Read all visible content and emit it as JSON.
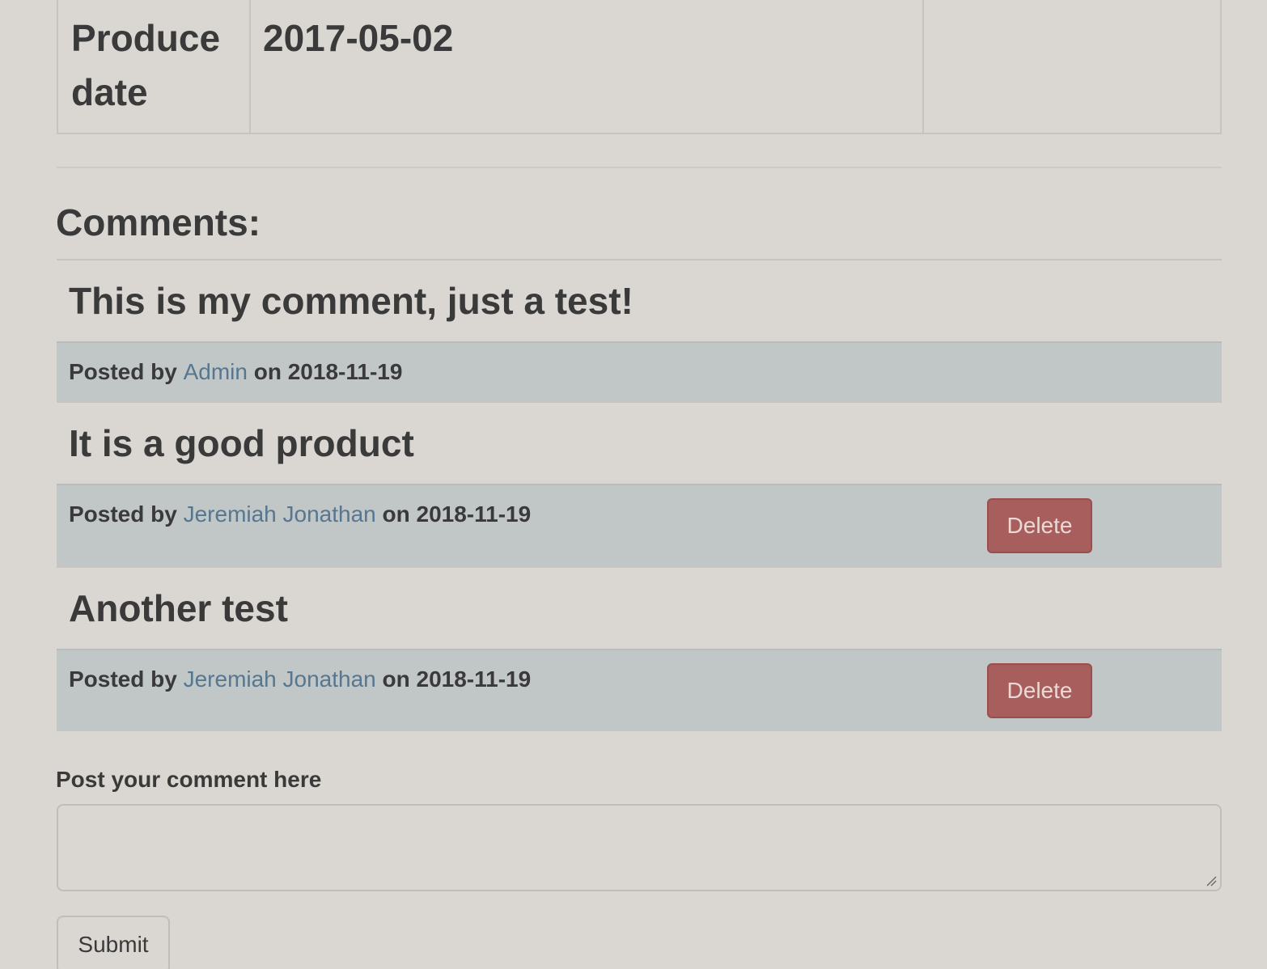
{
  "details": {
    "rows": [
      {
        "label": "Produce date",
        "value": "2017-05-02",
        "extra": ""
      }
    ]
  },
  "comments": {
    "heading": "Comments:",
    "items": [
      {
        "text": "This is my comment, just a test!",
        "posted_prefix": "Posted by ",
        "author": "Admin",
        "date_prefix": " on ",
        "date": "2018-11-19",
        "delete_label": ""
      },
      {
        "text": "It is a good product",
        "posted_prefix": "Posted by ",
        "author": "Jeremiah Jonathan",
        "date_prefix": " on ",
        "date": "2018-11-19",
        "delete_label": "Delete"
      },
      {
        "text": "Another test",
        "posted_prefix": "Posted by ",
        "author": "Jeremiah Jonathan",
        "date_prefix": " on ",
        "date": "2018-11-19",
        "delete_label": "Delete"
      }
    ]
  },
  "form": {
    "label": "Post your comment here",
    "textarea_value": "",
    "textarea_placeholder": "",
    "submit_label": "Submit"
  },
  "colors": {
    "background": "#dad7d3",
    "footer_bg": "#c1c6c7",
    "link": "#56778f",
    "danger": "#a75e5d"
  }
}
